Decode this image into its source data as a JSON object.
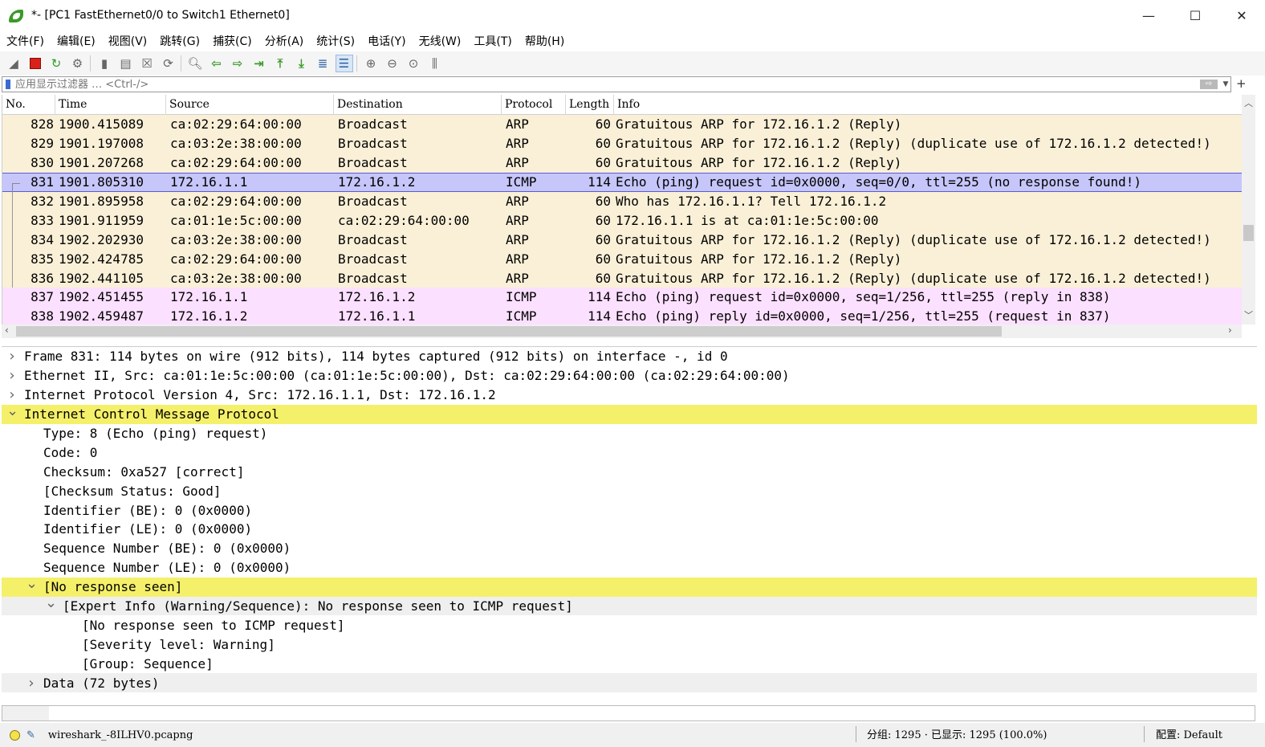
{
  "window": {
    "title": "*- [PC1 FastEthernet0/0 to Switch1 Ethernet0]",
    "minimize": "—",
    "maximize": "☐",
    "close": "✕"
  },
  "menu": [
    "文件(F)",
    "编辑(E)",
    "视图(V)",
    "跳转(G)",
    "捕获(C)",
    "分析(A)",
    "统计(S)",
    "电话(Y)",
    "无线(W)",
    "工具(T)",
    "帮助(H)"
  ],
  "filter": {
    "placeholder": "应用显示过滤器 … <Ctrl-/>",
    "plus": "+"
  },
  "packet_list": {
    "columns": [
      "No.",
      "Time",
      "Source",
      "Destination",
      "Protocol",
      "Length",
      "Info"
    ],
    "rows": [
      {
        "no": "828",
        "time": "1900.415089",
        "src": "ca:02:29:64:00:00",
        "dst": "Broadcast",
        "proto": "ARP",
        "len": "60",
        "info": "Gratuitous ARP for 172.16.1.2 (Reply)",
        "kind": "arp"
      },
      {
        "no": "829",
        "time": "1901.197008",
        "src": "ca:03:2e:38:00:00",
        "dst": "Broadcast",
        "proto": "ARP",
        "len": "60",
        "info": "Gratuitous ARP for 172.16.1.2 (Reply) (duplicate use of 172.16.1.2 detected!)",
        "kind": "arp"
      },
      {
        "no": "830",
        "time": "1901.207268",
        "src": "ca:02:29:64:00:00",
        "dst": "Broadcast",
        "proto": "ARP",
        "len": "60",
        "info": "Gratuitous ARP for 172.16.1.2 (Reply)",
        "kind": "arp"
      },
      {
        "no": "831",
        "time": "1901.805310",
        "src": "172.16.1.1",
        "dst": "172.16.1.2",
        "proto": "ICMP",
        "len": "114",
        "info": "Echo (ping) request  id=0x0000, seq=0/0, ttl=255 (no response found!)",
        "kind": "selected"
      },
      {
        "no": "832",
        "time": "1901.895958",
        "src": "ca:02:29:64:00:00",
        "dst": "Broadcast",
        "proto": "ARP",
        "len": "60",
        "info": "Who has 172.16.1.1? Tell 172.16.1.2",
        "kind": "arp"
      },
      {
        "no": "833",
        "time": "1901.911959",
        "src": "ca:01:1e:5c:00:00",
        "dst": "ca:02:29:64:00:00",
        "proto": "ARP",
        "len": "60",
        "info": "172.16.1.1 is at ca:01:1e:5c:00:00",
        "kind": "arp"
      },
      {
        "no": "834",
        "time": "1902.202930",
        "src": "ca:03:2e:38:00:00",
        "dst": "Broadcast",
        "proto": "ARP",
        "len": "60",
        "info": "Gratuitous ARP for 172.16.1.2 (Reply) (duplicate use of 172.16.1.2 detected!)",
        "kind": "arp"
      },
      {
        "no": "835",
        "time": "1902.424785",
        "src": "ca:02:29:64:00:00",
        "dst": "Broadcast",
        "proto": "ARP",
        "len": "60",
        "info": "Gratuitous ARP for 172.16.1.2 (Reply)",
        "kind": "arp"
      },
      {
        "no": "836",
        "time": "1902.441105",
        "src": "ca:03:2e:38:00:00",
        "dst": "Broadcast",
        "proto": "ARP",
        "len": "60",
        "info": "Gratuitous ARP for 172.16.1.2 (Reply) (duplicate use of 172.16.1.2 detected!)",
        "kind": "arp"
      },
      {
        "no": "837",
        "time": "1902.451455",
        "src": "172.16.1.1",
        "dst": "172.16.1.2",
        "proto": "ICMP",
        "len": "114",
        "info": "Echo (ping) request  id=0x0000, seq=1/256, ttl=255 (reply in 838)",
        "kind": "icmp"
      },
      {
        "no": "838",
        "time": "1902.459487",
        "src": "172.16.1.2",
        "dst": "172.16.1.1",
        "proto": "ICMP",
        "len": "114",
        "info": "Echo (ping) reply    id=0x0000, seq=1/256, ttl=255 (request in 837)",
        "kind": "icmp"
      }
    ]
  },
  "details": [
    {
      "text": "Frame 831: 114 bytes on wire (912 bits), 114 bytes captured (912 bits) on interface -, id 0",
      "indent": 0,
      "twisty": ">",
      "style": ""
    },
    {
      "text": "Ethernet II, Src: ca:01:1e:5c:00:00 (ca:01:1e:5c:00:00), Dst: ca:02:29:64:00:00 (ca:02:29:64:00:00)",
      "indent": 0,
      "twisty": ">",
      "style": ""
    },
    {
      "text": "Internet Protocol Version 4, Src: 172.16.1.1, Dst: 172.16.1.2",
      "indent": 0,
      "twisty": ">",
      "style": ""
    },
    {
      "text": "Internet Control Message Protocol",
      "indent": 0,
      "twisty": "v",
      "style": "hl"
    },
    {
      "text": "Type: 8 (Echo (ping) request)",
      "indent": 1,
      "twisty": "",
      "style": ""
    },
    {
      "text": "Code: 0",
      "indent": 1,
      "twisty": "",
      "style": ""
    },
    {
      "text": "Checksum: 0xa527 [correct]",
      "indent": 1,
      "twisty": "",
      "style": ""
    },
    {
      "text": "[Checksum Status: Good]",
      "indent": 1,
      "twisty": "",
      "style": ""
    },
    {
      "text": "Identifier (BE): 0 (0x0000)",
      "indent": 1,
      "twisty": "",
      "style": ""
    },
    {
      "text": "Identifier (LE): 0 (0x0000)",
      "indent": 1,
      "twisty": "",
      "style": ""
    },
    {
      "text": "Sequence Number (BE): 0 (0x0000)",
      "indent": 1,
      "twisty": "",
      "style": ""
    },
    {
      "text": "Sequence Number (LE): 0 (0x0000)",
      "indent": 1,
      "twisty": "",
      "style": ""
    },
    {
      "text": "[No response seen]",
      "indent": 1,
      "twisty": "v",
      "style": "hl"
    },
    {
      "text": "[Expert Info (Warning/Sequence): No response seen to ICMP request]",
      "indent": 2,
      "twisty": "v",
      "style": "gray"
    },
    {
      "text": "[No response seen to ICMP request]",
      "indent": 3,
      "twisty": "",
      "style": ""
    },
    {
      "text": "[Severity level: Warning]",
      "indent": 3,
      "twisty": "",
      "style": ""
    },
    {
      "text": "[Group: Sequence]",
      "indent": 3,
      "twisty": "",
      "style": ""
    },
    {
      "text": "Data (72 bytes)",
      "indent": 1,
      "twisty": ">",
      "style": "gray"
    }
  ],
  "status": {
    "file": "wireshark_-8ILHV0.pcapng",
    "packets": "分组: 1295 · 已显示: 1295 (100.0%)",
    "profile": "配置: Default"
  },
  "colors": {
    "arp_row": "#faf0d7",
    "icmp_row": "#fce0ff",
    "selected_row": "#c6c6fa",
    "highlight": "#f5f06a"
  }
}
